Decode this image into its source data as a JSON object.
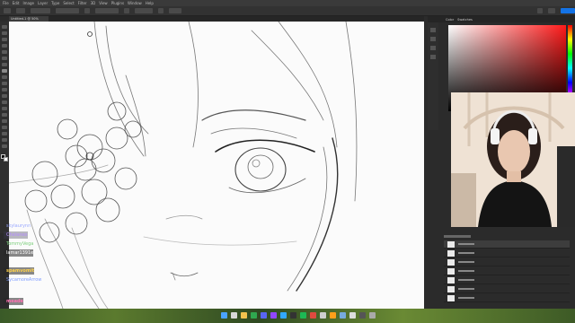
{
  "menu": [
    "File",
    "Edit",
    "Image",
    "Layer",
    "Type",
    "Select",
    "Filter",
    "3D",
    "View",
    "Plugins",
    "Window",
    "Help"
  ],
  "document": {
    "tab_label": "Untitled-1 @ 50%"
  },
  "panels": {
    "tabs": [
      "Color",
      "Swatches"
    ]
  },
  "chat": {
    "messages": [
      {
        "user": "skylaurynn",
        "color": "#9aa8ff"
      },
      {
        "user": "Chelaneo",
        "color": "#b38cff"
      },
      {
        "user": "TommyVega",
        "color": "#7ccf7c"
      },
      {
        "user": "lamar1391e",
        "color": "#ffffff"
      },
      {
        "user": "spamvomit",
        "color": "#ffd24a"
      },
      {
        "user": "SycamoreArrow",
        "color": "#7f9dff"
      },
      {
        "user": "meade",
        "color": "#ff6fb0"
      }
    ]
  },
  "taskbar": {
    "time": "",
    "date": ""
  }
}
